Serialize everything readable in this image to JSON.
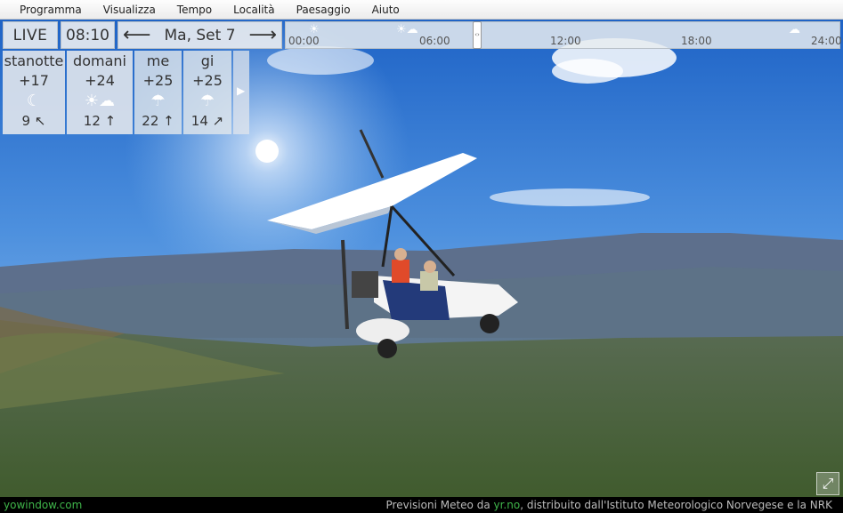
{
  "menu": {
    "items": [
      "Programma",
      "Visualizza",
      "Tempo",
      "Località",
      "Paesaggio",
      "Aiuto"
    ]
  },
  "toolbar": {
    "live_label": "LIVE",
    "time": "08:10",
    "prev_arrow": "⟵",
    "next_arrow": "⟶",
    "date": "Ma, Set 7"
  },
  "timeline": {
    "ticks": [
      "00:00",
      "06:00",
      "12:00",
      "18:00",
      "24:00"
    ],
    "thumb_glyph": "‹›",
    "icons": [
      "sun-icon",
      "partly-cloudy-icon",
      "cloud-icon"
    ]
  },
  "forecast": {
    "days": [
      {
        "day": "stanotte",
        "temp": "+17",
        "icon": "moon-icon",
        "glyph": "☾",
        "wind": "9 ↖"
      },
      {
        "day": "domani",
        "temp": "+24",
        "icon": "partly-cloudy-icon",
        "glyph": "☀☁",
        "wind": "12 ↑"
      },
      {
        "day": "me",
        "temp": "+25",
        "icon": "rain-cloud-icon",
        "glyph": "☂",
        "wind": "22 ↑"
      },
      {
        "day": "gi",
        "temp": "+25",
        "icon": "rain-cloud-icon",
        "glyph": "☂",
        "wind": "14 ↗"
      }
    ],
    "next_glyph": "▶"
  },
  "bottom": {
    "brand": "yowindow.com",
    "credit_prefix": "Previsioni Meteo da ",
    "credit_link": "yr.no",
    "credit_suffix": ", distribuito dall'Istituto Meteorologico Norvegese e la NRK"
  },
  "colors": {
    "sky_top": "#1f66c8",
    "sky_bottom": "#7fb4e6",
    "brand_green": "#3fb54a"
  }
}
